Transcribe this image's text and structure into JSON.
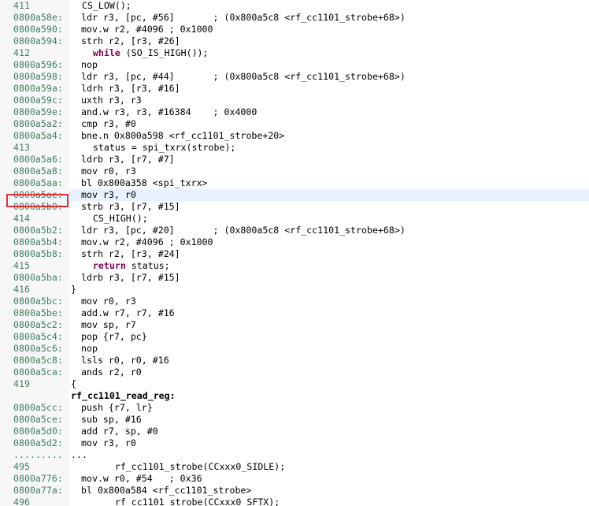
{
  "lines": [
    {
      "addr": "411",
      "text": "  CS_LOW();",
      "src": true
    },
    {
      "addr": "0800a58e:",
      "text": "ldr r3, [pc, #56]       ; (0x800a5c8 <rf_cc1101_strobe+68>)"
    },
    {
      "addr": "0800a590:",
      "text": "mov.w r2, #4096 ; 0x1000"
    },
    {
      "addr": "0800a594:",
      "text": "strh r2, [r3, #26]"
    },
    {
      "addr": "412",
      "src": true,
      "parts": [
        {
          "t": "    "
        },
        {
          "t": "while",
          "kw": true
        },
        {
          "t": " (SO_IS_HIGH());"
        }
      ]
    },
    {
      "addr": "0800a596:",
      "text": "nop"
    },
    {
      "addr": "0800a598:",
      "text": "ldr r3, [pc, #44]       ; (0x800a5c8 <rf_cc1101_strobe+68>)"
    },
    {
      "addr": "0800a59a:",
      "text": "ldrh r3, [r3, #16]"
    },
    {
      "addr": "0800a59c:",
      "text": "uxth r3, r3"
    },
    {
      "addr": "0800a59e:",
      "text": "and.w r3, r3, #16384    ; 0x4000"
    },
    {
      "addr": "0800a5a2:",
      "text": "cmp r3, #0"
    },
    {
      "addr": "0800a5a4:",
      "text": "bne.n 0x800a598 <rf_cc1101_strobe+20>"
    },
    {
      "addr": "413",
      "text": "    status = spi_txrx(strobe);",
      "src": true
    },
    {
      "addr": "0800a5a6:",
      "text": "ldrb r3, [r7, #7]"
    },
    {
      "addr": "0800a5a8:",
      "text": "mov r0, r3"
    },
    {
      "addr": "0800a5aa:",
      "text": "bl 0x800a358 <spi_txrx>"
    },
    {
      "addr": "0800a5ae:",
      "text": "mov r3, r0",
      "highlight": true
    },
    {
      "addr": "0800a5b0:",
      "text": "strb r3, [r7, #15]"
    },
    {
      "addr": "414",
      "text": "    CS_HIGH();",
      "src": true
    },
    {
      "addr": "0800a5b2:",
      "text": "ldr r3, [pc, #20]       ; (0x800a5c8 <rf_cc1101_strobe+68>)"
    },
    {
      "addr": "0800a5b4:",
      "text": "mov.w r2, #4096 ; 0x1000"
    },
    {
      "addr": "0800a5b8:",
      "text": "strh r2, [r3, #24]"
    },
    {
      "addr": "415",
      "src": true,
      "parts": [
        {
          "t": "    "
        },
        {
          "t": "return",
          "kw": true
        },
        {
          "t": " status;"
        }
      ]
    },
    {
      "addr": "0800a5ba:",
      "text": "ldrb r3, [r7, #15]"
    },
    {
      "addr": "416",
      "text": "}",
      "src": true
    },
    {
      "addr": "0800a5bc:",
      "text": "mov r0, r3"
    },
    {
      "addr": "0800a5be:",
      "text": "add.w r7, r7, #16"
    },
    {
      "addr": "0800a5c2:",
      "text": "mov sp, r7"
    },
    {
      "addr": "0800a5c4:",
      "text": "pop {r7, pc}"
    },
    {
      "addr": "0800a5c6:",
      "text": "nop"
    },
    {
      "addr": "0800a5c8:",
      "text": "lsls r0, r0, #16"
    },
    {
      "addr": "0800a5ca:",
      "text": "ands r2, r0"
    },
    {
      "addr": "419",
      "text": "{",
      "src": true
    },
    {
      "addr": "",
      "text": "rf_cc1101_read_reg:",
      "src": true,
      "label": true
    },
    {
      "addr": "0800a5cc:",
      "text": "push {r7, lr}"
    },
    {
      "addr": "0800a5ce:",
      "text": "sub sp, #16"
    },
    {
      "addr": "0800a5d0:",
      "text": "add r7, sp, #0"
    },
    {
      "addr": "0800a5d2:",
      "text": "mov r3, r0"
    },
    {
      "addr": ".........",
      "text": "...",
      "src": true
    },
    {
      "addr": "495",
      "text": "        rf_cc1101_strobe(CCxxx0_SIDLE);",
      "src": true
    },
    {
      "addr": "0800a776:",
      "text": "mov.w r0, #54   ; 0x36"
    },
    {
      "addr": "0800a77a:",
      "text": "bl 0x800a584 <rf_cc1101_strobe>"
    },
    {
      "addr": "496",
      "text": "        rf_cc1101_strobe(CCxxx0_SFTX);",
      "src": true
    }
  ]
}
